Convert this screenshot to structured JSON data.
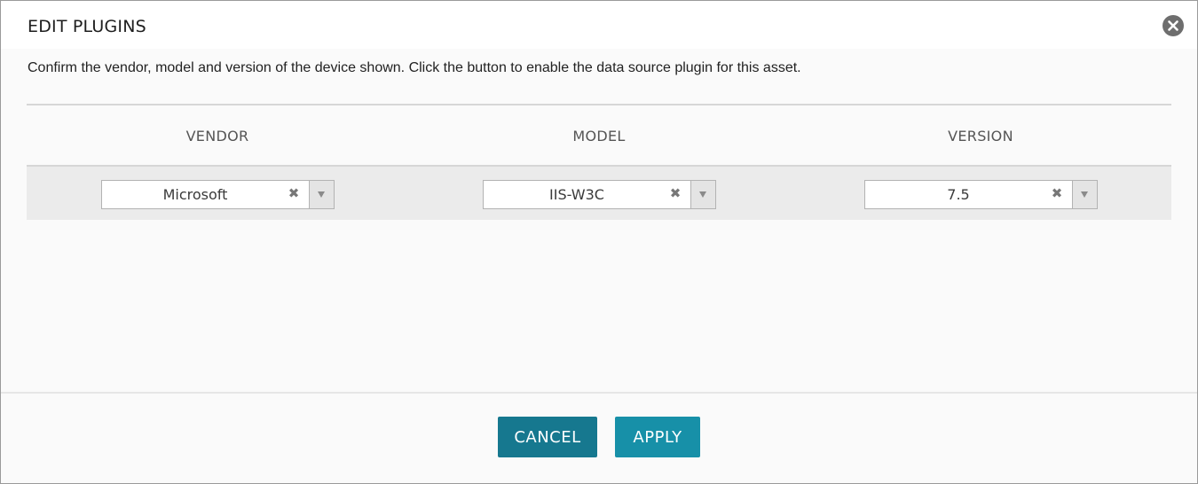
{
  "dialog": {
    "title": "EDIT PLUGINS",
    "close_icon": "close-circle-icon",
    "description": "Confirm the vendor, model and version of the device shown. Click the button to enable the data source plugin for this asset."
  },
  "table": {
    "columns": [
      "VENDOR",
      "MODEL",
      "VERSION"
    ],
    "row": {
      "vendor": "Microsoft",
      "model": "IIS-W3C",
      "version": "7.5"
    },
    "clear_glyph": "✖"
  },
  "footer": {
    "cancel_label": "CANCEL",
    "apply_label": "APPLY"
  },
  "colors": {
    "cancel_button": "#16788f",
    "apply_button": "#1790a8",
    "row_background": "#ebebeb",
    "close_icon": "#6e6e6e"
  }
}
